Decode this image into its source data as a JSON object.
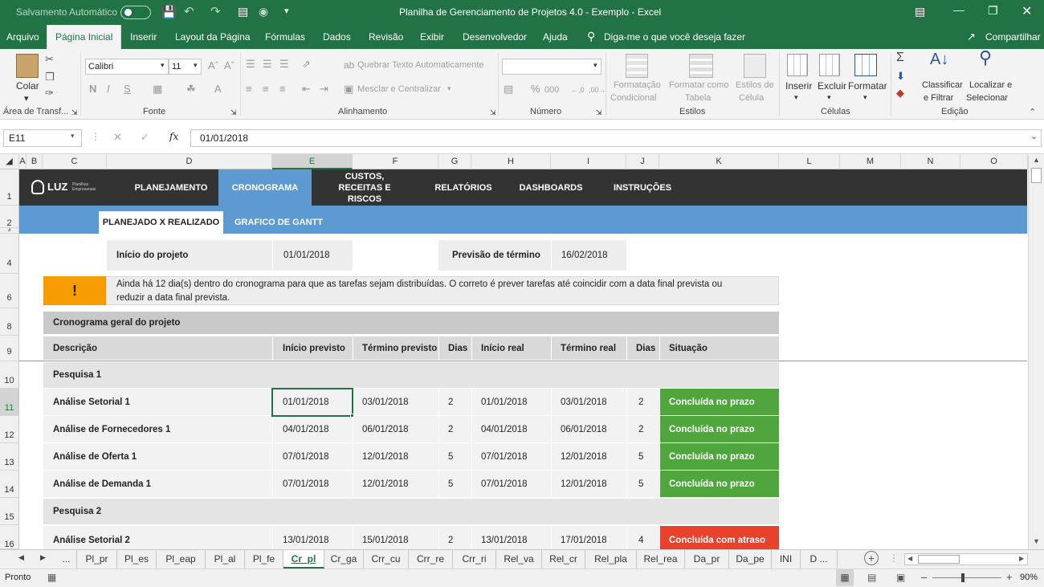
{
  "titlebar": {
    "autosave": "Salvamento Automático",
    "autosave_state": "off",
    "title": "Planilha de Gerenciamento de Projetos 4.0 - Exemplo  -  Excel"
  },
  "menu": {
    "tabs": [
      "Arquivo",
      "Página Inicial",
      "Inserir",
      "Layout da Página",
      "Fórmulas",
      "Dados",
      "Revisão",
      "Exibir",
      "Desenvolvedor",
      "Ajuda"
    ],
    "tell_me": "Diga-me o que você deseja fazer",
    "share": "Compartilhar"
  },
  "ribbon": {
    "paste": "Colar",
    "clipboard": "Área de Transf...",
    "font_name": "Calibri",
    "font_size": "11",
    "font_group": "Fonte",
    "wrap_text": "Quebrar Texto Automaticamente",
    "merge_center": "Mesclar e Centralizar",
    "alignment_group": "Alinhamento",
    "percent": "%",
    "thousands": "000",
    "number_group": "Número",
    "cond_format": [
      "Formatação",
      "Condicional"
    ],
    "format_table": [
      "Formatar como",
      "Tabela"
    ],
    "cell_styles": [
      "Estilos de",
      "Célula"
    ],
    "styles_group": "Estilos",
    "insert": "Inserir",
    "delete": "Excluir",
    "format": "Formatar",
    "cells_group": "Células",
    "sort_filter": [
      "Classificar",
      "e Filtrar"
    ],
    "find_select": [
      "Localizar e",
      "Selecionar"
    ],
    "editing_group": "Edição"
  },
  "formula_bar": {
    "name_box": "E11",
    "fx": "fx",
    "value": "01/01/2018"
  },
  "columns": [
    "A",
    "B",
    "C",
    "D",
    "E",
    "F",
    "G",
    "H",
    "I",
    "J",
    "K",
    "L",
    "M",
    "N",
    "O"
  ],
  "rows": [
    "1",
    "2",
    "3",
    "4",
    "6",
    "8",
    "9",
    "10",
    "11",
    "12",
    "13",
    "14",
    "15",
    "16"
  ],
  "sheet": {
    "logo": "LUZ",
    "logo_sub": "Planilhas Empresariais",
    "nav": [
      "PLANEJAMENTO",
      "CRONOGRAMA",
      "CUSTOS, RECEITAS E RISCOS",
      "RELATÓRIOS",
      "DASHBOARDS",
      "INSTRUÇÕES"
    ],
    "subnav": [
      "PLANEJADO X REALIZADO",
      "GRAFICO DE GANTT"
    ],
    "start_label": "Início do projeto",
    "start_value": "01/01/2018",
    "end_label": "Previsão de término",
    "end_value": "16/02/2018",
    "alert_icon": "!",
    "alert_text": [
      "Ainda há 12 dia(s) dentro do cronograma para que as tarefas sejam distribuídas. O correto é prever tarefas até coincidir com a data final prevista ou",
      "reduzir a data final prevista."
    ],
    "table_title": "Cronograma geral do projeto",
    "headers": [
      "Descrição",
      "Início previsto",
      "Término previsto",
      "Dias",
      "Início real",
      "Término real",
      "Dias",
      "Situação"
    ],
    "groups": [
      {
        "name": "Pesquisa 1"
      },
      {
        "name": "Pesquisa 2"
      }
    ],
    "tasks": [
      {
        "desc": "Análise Setorial 1",
        "ip": "01/01/2018",
        "tp": "03/01/2018",
        "dp": "2",
        "ir": "01/01/2018",
        "tr": "03/01/2018",
        "dr": "2",
        "status": "Concluída no prazo",
        "status_color": "#4fa63d"
      },
      {
        "desc": "Análise de Fornecedores 1",
        "ip": "04/01/2018",
        "tp": "06/01/2018",
        "dp": "2",
        "ir": "04/01/2018",
        "tr": "06/01/2018",
        "dr": "2",
        "status": "Concluída no prazo",
        "status_color": "#4fa63d"
      },
      {
        "desc": "Análise de Oferta 1",
        "ip": "07/01/2018",
        "tp": "12/01/2018",
        "dp": "5",
        "ir": "07/01/2018",
        "tr": "12/01/2018",
        "dr": "5",
        "status": "Concluída no prazo",
        "status_color": "#4fa63d"
      },
      {
        "desc": "Análise de Demanda 1",
        "ip": "07/01/2018",
        "tp": "12/01/2018",
        "dp": "5",
        "ir": "07/01/2018",
        "tr": "12/01/2018",
        "dr": "5",
        "status": "Concluída no prazo",
        "status_color": "#4fa63d"
      },
      {
        "desc": "Análise Setorial 2",
        "ip": "13/01/2018",
        "tp": "15/01/2018",
        "dp": "2",
        "ir": "13/01/2018",
        "tr": "17/01/2018",
        "dr": "4",
        "status": "Concluída com atraso",
        "status_color": "#e8412c"
      }
    ]
  },
  "sheet_tabs": [
    "...",
    "Pl_pr",
    "Pl_es",
    "Pl_eap",
    "Pl_al",
    "Pl_fe",
    "Cr_pl",
    "Cr_ga",
    "Crr_cu",
    "Crr_re",
    "Crr_ri",
    "Rel_va",
    "Rel_cr",
    "Rel_pla",
    "Rel_rea",
    "Da_pr",
    "Da_pe",
    "INI",
    "D ..."
  ],
  "active_sheet": "Cr_pl",
  "status": {
    "ready": "Pronto",
    "zoom": "90%"
  },
  "colors": {
    "excel_green": "#217346",
    "nav_dark": "#333333",
    "nav_blue": "#5e9ad2",
    "alert_orange": "#f59c00"
  }
}
